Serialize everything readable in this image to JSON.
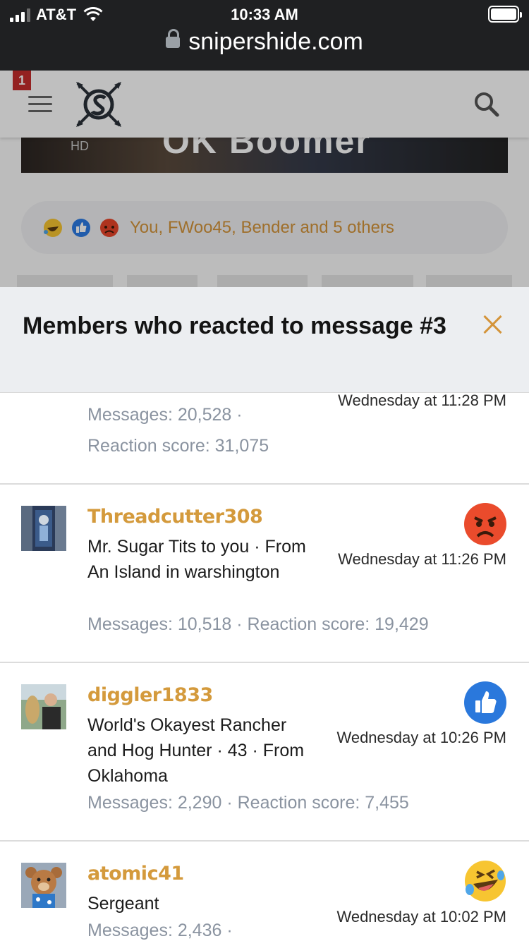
{
  "status_bar": {
    "carrier": "AT&T",
    "time": "10:33 AM",
    "url": "snipershide.com"
  },
  "header": {
    "notification_count": "1",
    "image_caption": "OK Boomer",
    "image_hd": "HD"
  },
  "reaction_bar": {
    "text": "You, FWoo45, Bender and 5 others",
    "icons": [
      "laugh-icon",
      "like-icon",
      "angry-icon"
    ]
  },
  "modal": {
    "title": "Members who reacted to message #3"
  },
  "members": [
    {
      "username": "",
      "title": "",
      "stats_line1": "Messages: 20,528 ·",
      "stats_line2": "Reaction score: 31,075",
      "date": "Wednesday at 11:28 PM",
      "reaction": ""
    },
    {
      "username": "Threadcutter308",
      "title": "Mr. Sugar Tits to you · From An Island in warshington",
      "stats_line1": "Messages: 10,518 · Reaction score: 19,429",
      "stats_line2": "",
      "date": "Wednesday at 11:26 PM",
      "reaction": "angry-icon"
    },
    {
      "username": "diggler1833",
      "title": "World's Okayest Rancher and Hog Hunter · 43 · From Oklahoma",
      "stats_line1": "Messages: 2,290 · Reaction score: 7,455",
      "stats_line2": "",
      "date": "Wednesday at 10:26 PM",
      "reaction": "like-icon"
    },
    {
      "username": "atomic41",
      "title": "Sergeant",
      "stats_line1": "Messages: 2,436 ·",
      "stats_line2": "",
      "date": "Wednesday at 10:02 PM",
      "reaction": "laugh-icon"
    }
  ],
  "colors": {
    "accent": "#d4943a",
    "username": "#d49a3c",
    "meta": "#8a93a0"
  }
}
